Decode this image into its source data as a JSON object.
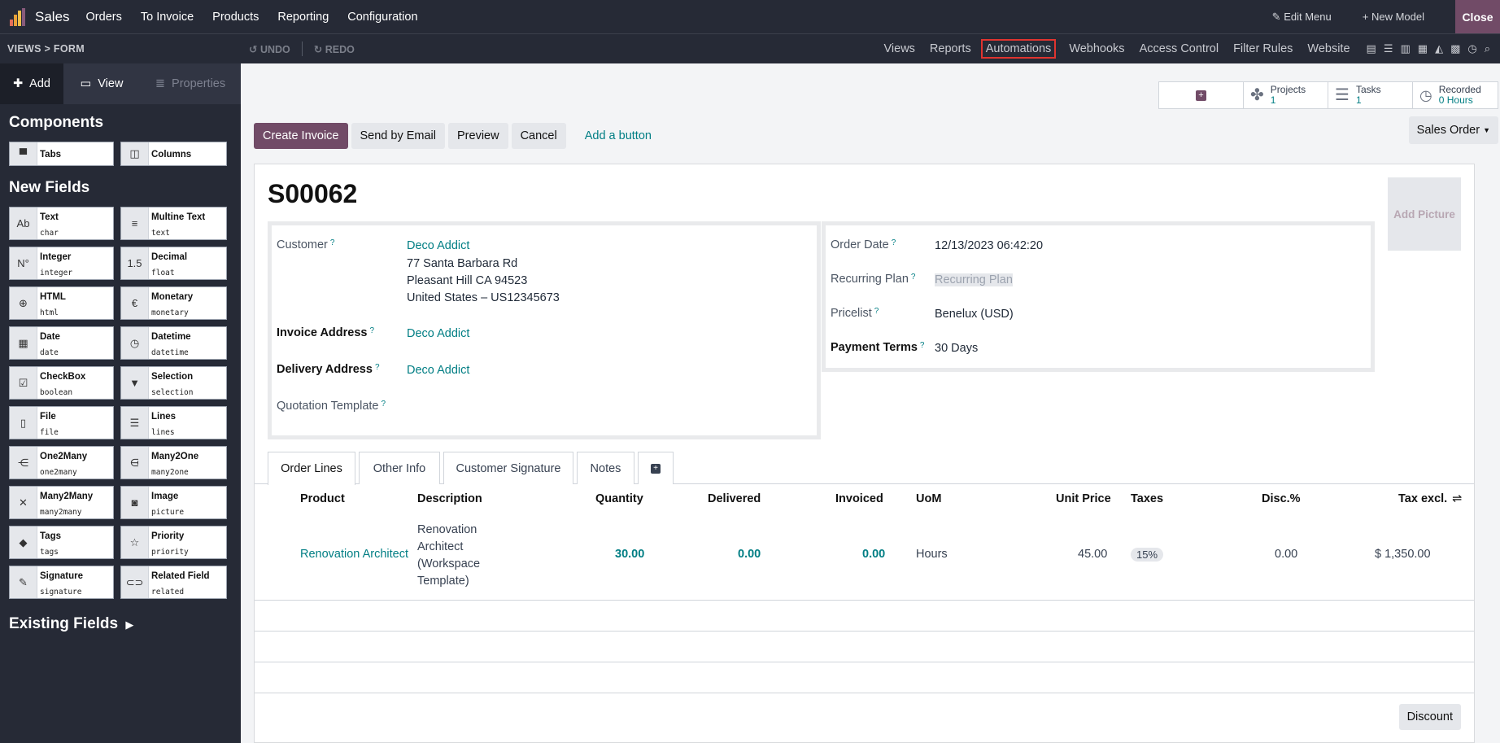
{
  "topbar": {
    "app": "Sales",
    "menus": [
      "Orders",
      "To Invoice",
      "Products",
      "Reporting",
      "Configuration"
    ],
    "edit_menu": "Edit Menu",
    "new_model": "New Model",
    "close": "Close"
  },
  "subbar": {
    "breadcrumb": "VIEWS  >  FORM",
    "undo": "UNDO",
    "redo": "REDO",
    "tabs": [
      "Views",
      "Reports",
      "Automations",
      "Webhooks",
      "Access Control",
      "Filter Rules",
      "Website"
    ]
  },
  "sidebar": {
    "tabs": {
      "add": "Add",
      "view": "View",
      "properties": "Properties"
    },
    "components_title": "Components",
    "components": [
      {
        "name": "Tabs"
      },
      {
        "name": "Columns"
      }
    ],
    "new_fields_title": "New Fields",
    "fields": [
      {
        "name": "Text",
        "type": "char",
        "icon": "Ab"
      },
      {
        "name": "Multine Text",
        "type": "text",
        "icon": "≡"
      },
      {
        "name": "Integer",
        "type": "integer",
        "icon": "N°"
      },
      {
        "name": "Decimal",
        "type": "float",
        "icon": "1.5"
      },
      {
        "name": "HTML",
        "type": "html",
        "icon": "⊕"
      },
      {
        "name": "Monetary",
        "type": "monetary",
        "icon": "€"
      },
      {
        "name": "Date",
        "type": "date",
        "icon": "▦"
      },
      {
        "name": "Datetime",
        "type": "datetime",
        "icon": "◷"
      },
      {
        "name": "CheckBox",
        "type": "boolean",
        "icon": "☑"
      },
      {
        "name": "Selection",
        "type": "selection",
        "icon": "▼"
      },
      {
        "name": "File",
        "type": "file",
        "icon": "▯"
      },
      {
        "name": "Lines",
        "type": "lines",
        "icon": "☰"
      },
      {
        "name": "One2Many",
        "type": "one2many",
        "icon": "⋲"
      },
      {
        "name": "Many2One",
        "type": "many2one",
        "icon": "⋳"
      },
      {
        "name": "Many2Many",
        "type": "many2many",
        "icon": "✕"
      },
      {
        "name": "Image",
        "type": "picture",
        "icon": "◙"
      },
      {
        "name": "Tags",
        "type": "tags",
        "icon": "◆"
      },
      {
        "name": "Priority",
        "type": "priority",
        "icon": "☆"
      },
      {
        "name": "Signature",
        "type": "signature",
        "icon": "✎"
      },
      {
        "name": "Related Field",
        "type": "related",
        "icon": "⊂⊃"
      }
    ],
    "existing": "Existing Fields"
  },
  "stat": {
    "projects_label": "Projects",
    "projects_value": "1",
    "tasks_label": "Tasks",
    "tasks_value": "1",
    "recorded_label": "Recorded",
    "recorded_value": "0 Hours"
  },
  "actions": {
    "create_invoice": "Create Invoice",
    "send_email": "Send by Email",
    "preview": "Preview",
    "cancel": "Cancel",
    "add_button": "Add a button",
    "sales_order": "Sales Order"
  },
  "form": {
    "name": "S00062",
    "add_picture": "Add Picture",
    "customer_label": "Customer",
    "customer": "Deco Addict",
    "address1": "77 Santa Barbara Rd",
    "address2": "Pleasant Hill CA 94523",
    "address3": "United States – US12345673",
    "invoice_label": "Invoice Address",
    "invoice": "Deco Addict",
    "delivery_label": "Delivery Address",
    "delivery": "Deco Addict",
    "quotation_label": "Quotation Template",
    "order_date_label": "Order Date",
    "order_date": "12/13/2023 06:42:20",
    "recurring_label": "Recurring Plan",
    "recurring_ph": "Recurring Plan",
    "pricelist_label": "Pricelist",
    "pricelist": "Benelux (USD)",
    "terms_label": "Payment Terms",
    "terms": "30 Days"
  },
  "notebook": {
    "tabs": [
      "Order Lines",
      "Other Info",
      "Customer Signature",
      "Notes"
    ]
  },
  "table": {
    "headers": {
      "product": "Product",
      "description": "Description",
      "quantity": "Quantity",
      "delivered": "Delivered",
      "invoiced": "Invoiced",
      "uom": "UoM",
      "unit_price": "Unit Price",
      "taxes": "Taxes",
      "disc": "Disc.%",
      "tax_excl": "Tax excl."
    },
    "row": {
      "product": "Renovation Architect",
      "desc1": "Renovation",
      "desc2": "Architect",
      "desc3": "(Workspace",
      "desc4": "Template)",
      "quantity": "30.00",
      "delivered": "0.00",
      "invoiced": "0.00",
      "uom": "Hours",
      "unit_price": "45.00",
      "taxes": "15%",
      "disc": "0.00",
      "tax_excl": "$ 1,350.00"
    }
  },
  "discount": "Discount"
}
